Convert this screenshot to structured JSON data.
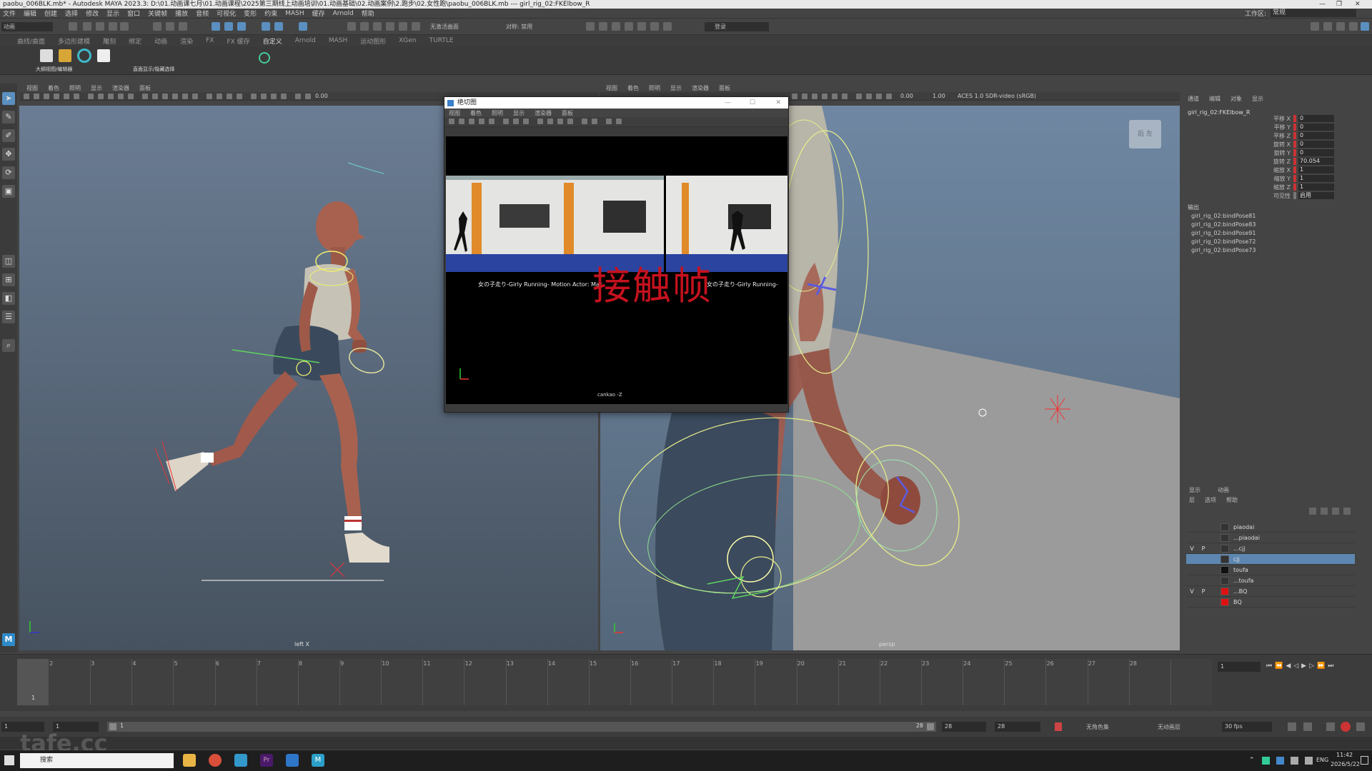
{
  "window": {
    "title": "paobu_006BLK.mb* - Autodesk MAYA 2023.3: D:\\01.动画课七月\\01.动画课程\\2025第三期线上动画培训\\01.动画基础\\02.动画案例\\2.跑步\\02.女性跑\\paobu_006BLK.mb  ---  girl_rig_02:FKElbow_R"
  },
  "menubar": {
    "items": [
      "文件",
      "编辑",
      "创建",
      "选择",
      "修改",
      "显示",
      "窗口",
      "关键帧",
      "播放",
      "音频",
      "可视化",
      "变形",
      "约束",
      "MASH",
      "缓存",
      "Arnold",
      "帮助"
    ],
    "workspace_label": "工作区:",
    "workspace_value": "常规"
  },
  "statusline": {
    "mode": "动画",
    "no_live": "无激活曲面",
    "symmetry": "对称: 禁用",
    "login": "登录"
  },
  "shelftabs": [
    "曲线/曲面",
    "多边形建模",
    "雕刻",
    "绑定",
    "动画",
    "渲染",
    "FX",
    "FX 缓存",
    "自定义",
    "Arnold",
    "MASH",
    "运动图形",
    "XGen",
    "TURTLE"
  ],
  "shelf_labels": [
    "大纲视图/编辑器",
    "直面显示/隐藏选择"
  ],
  "panel_menu": [
    "视图",
    "着色",
    "照明",
    "显示",
    "渲染器",
    "面板"
  ],
  "viewport_left": {
    "label": "left X",
    "time_value": "0.00"
  },
  "viewport_right": {
    "label": "persp",
    "near": "0.00",
    "far": "1.00",
    "color_space": "ACES 1.0 SDR-video (sRGB)",
    "cube_label": "后 左"
  },
  "float_window": {
    "title": "绝切图",
    "menu": [
      "视图",
      "着色",
      "照明",
      "显示",
      "渲染器",
      "面板"
    ],
    "subtitle_left": "女の子走り-Girly Running- Motion Actor: Mac",
    "subtitle_right": "女の子走り-Girly Running-",
    "overlay_text": "接触帧",
    "camera_label": "cankao -Z"
  },
  "attr_editor": {
    "tabs": [
      "通道",
      "编辑",
      "对象",
      "显示"
    ],
    "node": "girl_rig_02:FKElbow_R",
    "channels": [
      {
        "label": "平移 X",
        "value": "0"
      },
      {
        "label": "平移 Y",
        "value": "0"
      },
      {
        "label": "平移 Z",
        "value": "0"
      },
      {
        "label": "旋转 X",
        "value": "0"
      },
      {
        "label": "旋转 Y",
        "value": "0"
      },
      {
        "label": "旋转 Z",
        "value": "70.054"
      },
      {
        "label": "缩放 X",
        "value": "1"
      },
      {
        "label": "缩放 Y",
        "value": "1"
      },
      {
        "label": "缩放 Z",
        "value": "1"
      },
      {
        "label": "可见性",
        "value": "启用"
      }
    ],
    "outputs_header": "输出",
    "outputs": [
      "girl_rig_02:bindPose81",
      "girl_rig_02:bindPose83",
      "girl_rig_02:bindPose91",
      "girl_rig_02:bindPose72",
      "girl_rig_02:bindPose73"
    ]
  },
  "layers": {
    "tabs": [
      "显示",
      "动画"
    ],
    "menu": [
      "层",
      "选项",
      "帮助"
    ],
    "rows": [
      {
        "v": "",
        "p": "",
        "name": "piaodai",
        "color": "#333333",
        "sel": false
      },
      {
        "v": "",
        "p": "",
        "name": "...piaodai",
        "color": "#333333",
        "sel": false
      },
      {
        "v": "V",
        "p": "P",
        "name": "...cjj",
        "color": "#333333",
        "sel": false
      },
      {
        "v": "",
        "p": "",
        "name": "cjj",
        "color": "#333333",
        "sel": true
      },
      {
        "v": "",
        "p": "",
        "name": "toufa",
        "color": "#111111",
        "sel": false
      },
      {
        "v": "",
        "p": "",
        "name": "...toufa",
        "color": "#333333",
        "sel": false
      },
      {
        "v": "V",
        "p": "P",
        "name": "...BQ",
        "color": "#dd1111",
        "sel": false
      },
      {
        "v": "",
        "p": "",
        "name": "BQ",
        "color": "#dd1111",
        "sel": false
      }
    ]
  },
  "timeline": {
    "ticks": [
      "2",
      "3",
      "4",
      "5",
      "6",
      "7",
      "8",
      "9",
      "10",
      "11",
      "12",
      "13",
      "14",
      "15",
      "16",
      "17",
      "18",
      "19",
      "20",
      "21",
      "22",
      "23",
      "24",
      "25",
      "26",
      "27",
      "28"
    ],
    "current_frame": "1",
    "start_marker": "1"
  },
  "range": {
    "start": "1",
    "inner_start": "1",
    "slider_start": "1",
    "slider_end": "28",
    "end": "28",
    "end2": "28",
    "char_set": "无角色集",
    "anim_layer": "无动画层",
    "fps": "30 fps"
  },
  "taskbar": {
    "search_placeholder": "搜索",
    "ime": "ENG",
    "time": "11:42",
    "date": "2026/5/22"
  },
  "watermark": "tafe.cc"
}
